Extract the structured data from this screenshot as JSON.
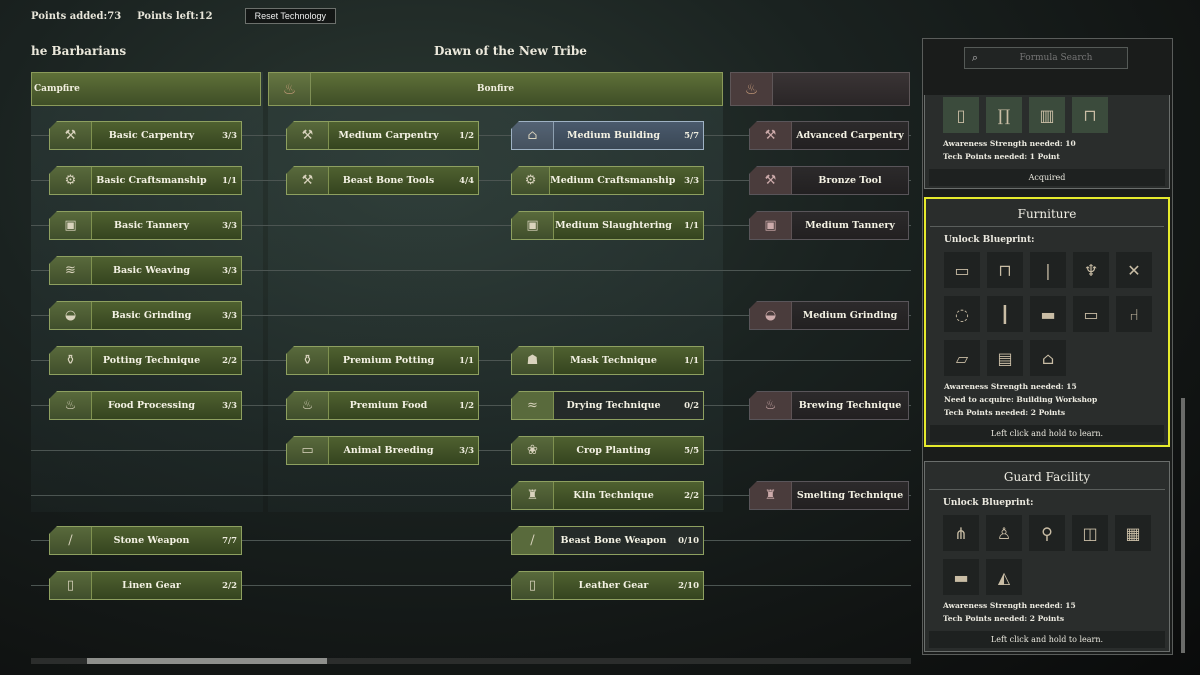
{
  "topbar": {
    "points_added": "Points added:73",
    "points_left": "Points left:12",
    "reset_label": "Reset Technology"
  },
  "eras": [
    {
      "title": "he Barbarians"
    },
    {
      "title": "Dawn of the New Tribe"
    }
  ],
  "tiers": [
    {
      "label": "Campfire",
      "icon": "campfire-icon"
    },
    {
      "label": "Bonfire",
      "icon": "bonfire-icon"
    },
    {
      "label": "",
      "icon": "locked-tier-icon"
    }
  ],
  "col1": [
    {
      "label": "Basic Carpentry",
      "count": "3/3",
      "glyph": "⚒"
    },
    {
      "label": "Basic Craftsmanship",
      "count": "1/1",
      "glyph": "⚙"
    },
    {
      "label": "Basic Tannery",
      "count": "3/3",
      "glyph": "▣"
    },
    {
      "label": "Basic Weaving",
      "count": "3/3",
      "glyph": "≋"
    },
    {
      "label": "Basic Grinding",
      "count": "3/3",
      "glyph": "◒"
    },
    {
      "label": "Potting Technique",
      "count": "2/2",
      "glyph": "⚱"
    },
    {
      "label": "Food Processing",
      "count": "3/3",
      "glyph": "♨"
    },
    {
      "label": "Stone Weapon",
      "count": "7/7",
      "glyph": "/"
    },
    {
      "label": "Linen Gear",
      "count": "2/2",
      "glyph": "▯"
    }
  ],
  "col2": [
    {
      "label": "Medium Carpentry",
      "count": "1/2",
      "glyph": "⚒"
    },
    {
      "label": "Beast Bone Tools",
      "count": "4/4",
      "glyph": "⚒"
    },
    {
      "label": "Premium Potting",
      "count": "1/1",
      "glyph": "⚱"
    },
    {
      "label": "Premium Food",
      "count": "1/2",
      "glyph": "♨"
    },
    {
      "label": "Animal Breeding",
      "count": "3/3",
      "glyph": "▭"
    }
  ],
  "col3": [
    {
      "label": "Medium Building",
      "count": "5/7",
      "glyph": "⌂"
    },
    {
      "label": "Medium Craftsmanship",
      "count": "3/3",
      "glyph": "⚙"
    },
    {
      "label": "Medium Slaughtering",
      "count": "1/1",
      "glyph": "▣"
    },
    {
      "label": "Mask Technique",
      "count": "1/1",
      "glyph": "☗"
    },
    {
      "label": "Drying Technique",
      "count": "0/2",
      "glyph": "≈"
    },
    {
      "label": "Crop Planting",
      "count": "5/5",
      "glyph": "❀"
    },
    {
      "label": "Kiln Technique",
      "count": "2/2",
      "glyph": "♜"
    },
    {
      "label": "Beast Bone Weapon",
      "count": "0/10",
      "glyph": "/"
    },
    {
      "label": "Leather Gear",
      "count": "2/10",
      "glyph": "▯"
    }
  ],
  "col4": [
    {
      "label": "Advanced Carpentry",
      "glyph": "⚒"
    },
    {
      "label": "Bronze Tool",
      "glyph": "⚒"
    },
    {
      "label": "Medium Tannery",
      "glyph": "▣"
    },
    {
      "label": "Medium Grinding",
      "glyph": "◒"
    },
    {
      "label": "Brewing Technique",
      "glyph": "♨"
    },
    {
      "label": "Smelting Technique",
      "glyph": "♜"
    }
  ],
  "sidebar": {
    "search_placeholder": "Formula Search",
    "prev_card": {
      "awareness": "Awareness Strength needed: 10",
      "points": "Tech Points needed: 1 Point",
      "status": "Acquired"
    },
    "furniture": {
      "title": "Furniture",
      "unlock": "Unlock Blueprint:",
      "awareness": "Awareness Strength needed: 15",
      "acquire": "Need to acquire: Building Workshop",
      "points": "Tech Points needed: 2 Points",
      "footer": "Left click and hold to learn."
    },
    "guard": {
      "title": "Guard Facility",
      "unlock": "Unlock Blueprint:",
      "awareness": "Awareness Strength needed: 15",
      "points": "Tech Points needed: 2 Points",
      "footer": "Left click and hold to learn."
    }
  }
}
